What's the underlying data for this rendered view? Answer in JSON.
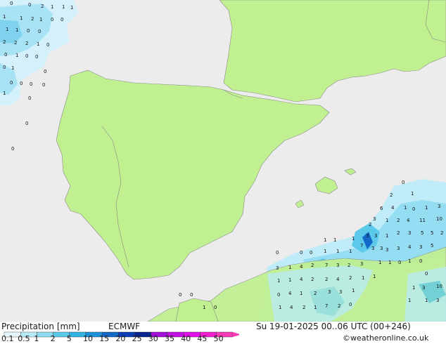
{
  "legend": {
    "title": "Precipitation [mm]",
    "model": "ECMWF",
    "ticks": [
      "0.1",
      "0.5",
      "1",
      "2",
      "5",
      "10",
      "15",
      "20",
      "25",
      "30",
      "35",
      "40",
      "45",
      "50"
    ],
    "colors": [
      "#e8f7ff",
      "#b8ebfa",
      "#8fdcf2",
      "#5cc9ea",
      "#32b2e0",
      "#1e90d8",
      "#1469c8",
      "#0c3fb4",
      "#08248f",
      "#a010d8",
      "#c010e0",
      "#e010e8",
      "#f020d0",
      "#f83cb8"
    ]
  },
  "datetime": "Su 19-01-2025 00..06 UTC (00+246)",
  "credit": "©weatheronline.co.uk",
  "colors": {
    "sea": "#ececec",
    "land": "#c0f090",
    "border": "#8a8a8a"
  }
}
